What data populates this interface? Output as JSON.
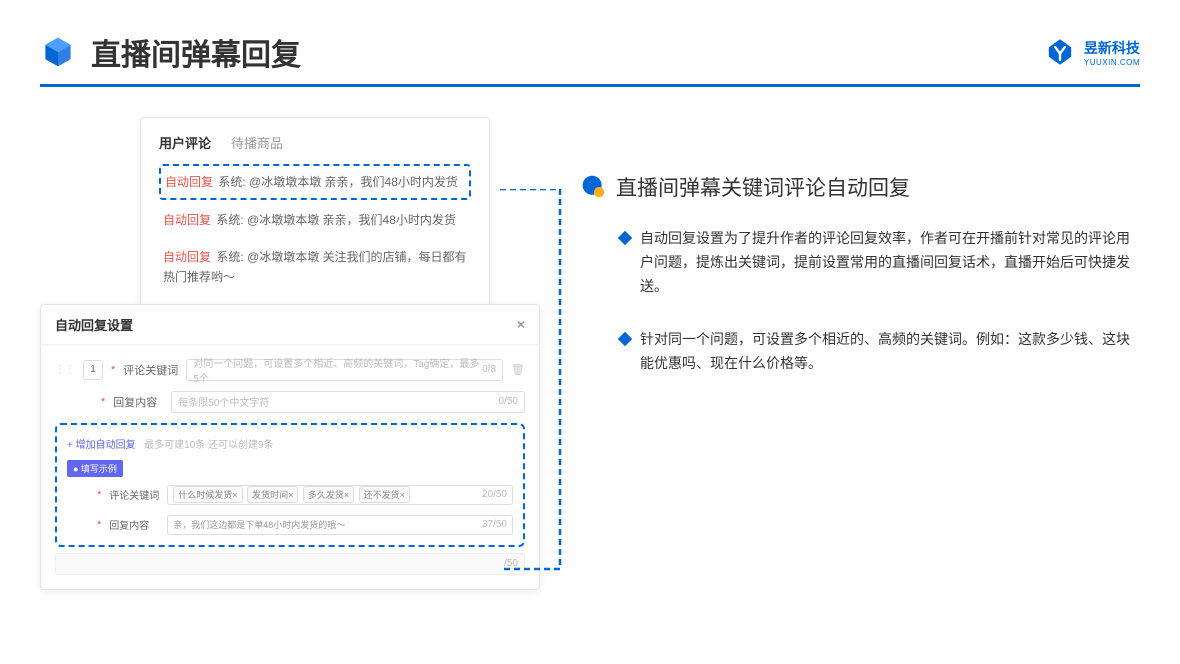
{
  "header": {
    "title": "直播间弹幕回复",
    "logo_cn": "昱新科技",
    "logo_en": "YUUXIN.COM"
  },
  "comments_panel": {
    "tab1": "用户评论",
    "tab2": "待播商品",
    "c1_label": "自动回复",
    "c1_text": " 系统: @冰墩墩本墩 亲亲，我们48小时内发货",
    "c2_label": "自动回复",
    "c2_text": " 系统: @冰墩墩本墩 亲亲，我们48小时内发货",
    "c3_label": "自动回复",
    "c3_text": " 系统: @冰墩墩本墩 关注我们的店铺，每日都有热门推荐哟～"
  },
  "settings": {
    "title": "自动回复设置",
    "num": "1",
    "label_keyword": "评论关键词",
    "placeholder_keyword": "对同一个问题，可设置多个相近、高频的关键词，Tag确定，最多5个",
    "counter_keyword": "0/8",
    "label_content": "回复内容",
    "placeholder_content": "每条限50个中文字符",
    "counter_content": "0/50",
    "add_link": "+ 增加自动回复",
    "add_hint": "最多可建10条 还可以创建9条",
    "example_badge": "● 填写示例",
    "ex_label_kw": "评论关键词",
    "ex_tag1": "什么时候发货×",
    "ex_tag2": "发货时间×",
    "ex_tag3": "多久发货×",
    "ex_tag4": "还不发货×",
    "ex_counter_kw": "20/50",
    "ex_label_content": "回复内容",
    "ex_content": "亲，我们这边都是下单48小时内发货的哦～",
    "ex_counter_content": "37/50",
    "outer_counter": "/50"
  },
  "right": {
    "section_title": "直播间弹幕关键词评论自动回复",
    "bullet1": "自动回复设置为了提升作者的评论回复效率，作者可在开播前针对常见的评论用户问题，提炼出关键词，提前设置常用的直播间回复话术，直播开始后可快捷发送。",
    "bullet2": "针对同一个问题，可设置多个相近的、高频的关键词。例如：这款多少钱、这块能优惠吗、现在什么价格等。"
  }
}
